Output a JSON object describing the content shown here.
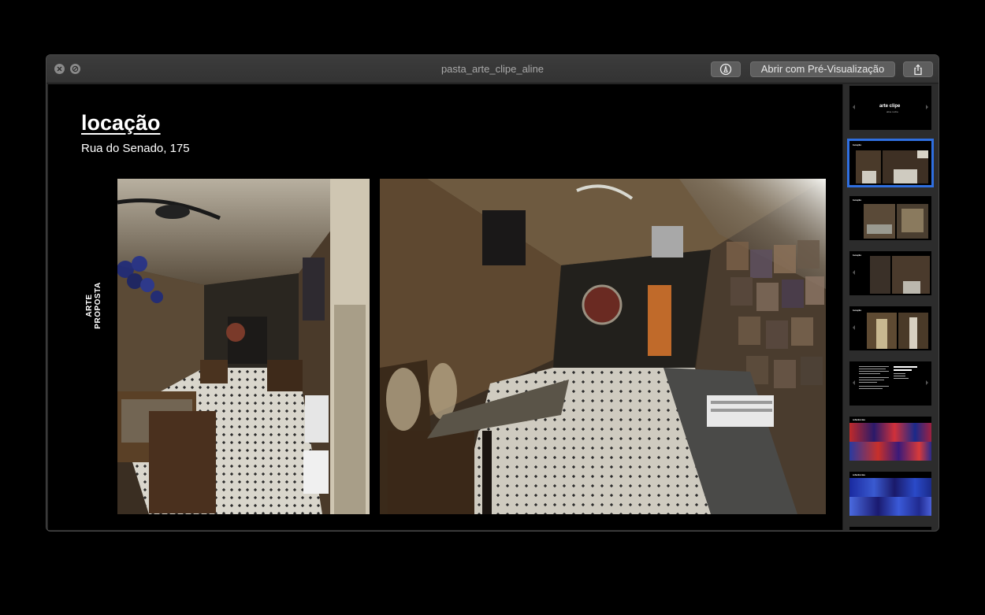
{
  "window": {
    "title": "pasta_arte_clipe_aline",
    "open_with_label": "Abrir com Pré-Visualização"
  },
  "toolbar": {
    "markup_icon": "markup-pen-circle-icon",
    "share_icon": "share-icon",
    "close_icon": "close-icon",
    "fullscreen_icon": "fullscreen-icon"
  },
  "slide": {
    "title": "locação",
    "subtitle": "Rua do Senado, 175",
    "side_label_line1": "ARTE",
    "side_label_line2": "PROPOSTA"
  },
  "thumbnails": [
    {
      "title": "arte clipe",
      "subtitle": "aline rocha",
      "selected": false
    },
    {
      "title": "locação",
      "selected": true
    },
    {
      "title": "locação",
      "selected": false
    },
    {
      "title": "locação",
      "selected": false
    },
    {
      "title": "locação",
      "selected": false
    },
    {
      "title": "",
      "selected": false
    },
    {
      "title": "referências",
      "selected": false
    },
    {
      "title": "referências",
      "selected": false
    }
  ],
  "colors": {
    "selection": "#2f6fe0",
    "background": "#000000",
    "chrome": "#333333"
  }
}
